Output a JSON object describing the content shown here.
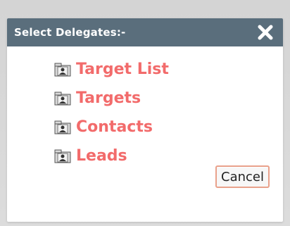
{
  "dialog": {
    "title": "Select Delegates:-",
    "close_icon": "close-icon",
    "items": [
      {
        "label": "Target List",
        "icon": "folder-person-icon"
      },
      {
        "label": "Targets",
        "icon": "folder-person-icon"
      },
      {
        "label": "Contacts",
        "icon": "folder-person-icon"
      },
      {
        "label": "Leads",
        "icon": "folder-person-icon"
      }
    ],
    "cancel_label": "Cancel"
  },
  "colors": {
    "titlebar": "#5a6e7c",
    "link": "#f26b6b",
    "button_border": "#e9a18b"
  }
}
